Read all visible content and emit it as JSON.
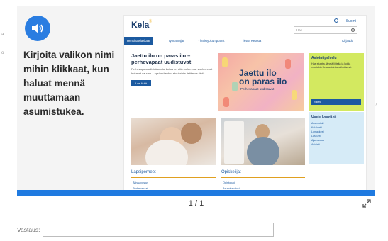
{
  "question": {
    "prompt": "Kirjoita valikon nimi mihin klikkaat, kun haluat mennä muuttamaan asumistukea.",
    "audio_icon": "speaker-icon"
  },
  "screenshot": {
    "logo": "Kela",
    "language": "Suomi",
    "search_placeholder": "Hae",
    "nav": {
      "items": [
        "Henkilöasiakkaat",
        "Työnantajat",
        "Yhteistyökumppanit",
        "Tietoa Kelasta"
      ],
      "login": "Kirjaudu"
    },
    "hero": {
      "title": "Jaettu ilo on paras ilo – perhevapaat uudistuvat",
      "body": "Perhevapaauudistuksen tarkoitus on että molemmat vanhemmat hoitavat vauvaa. Lapsiperheiden etuuksista lisätietoa tästä.",
      "button": "Lue lisää",
      "image_title_1": "Jaettu ilo",
      "image_title_2": "on paras ilo",
      "image_sub": "Perhevapaat uudistuvat"
    },
    "card_1": {
      "title": "Asiointipalvelu",
      "text": "Hae etuutta, lähetä liitteitä ja hoida muutakin Kela-asiointia sähköisesti.",
      "button": "Siirry"
    },
    "card_2": {
      "title": "Usein kysyttyä",
      "links": [
        "Asumistuki",
        "Kelakortti",
        "Lomakkeet",
        "Laskurit",
        "Ajanvaraus",
        "Asiointi"
      ]
    },
    "sections": [
      {
        "title": "Lapsiperheet",
        "links": [
          "Äitiysavustus",
          "Perhevapaat"
        ]
      },
      {
        "title": "Opiskelijat",
        "links": [
          "Opintotuki",
          "Asumisen tuki"
        ]
      }
    ]
  },
  "pager": {
    "indicator": "1 / 1",
    "progress": 1.0
  },
  "answer": {
    "label": "Vastaus:",
    "value": ""
  }
}
